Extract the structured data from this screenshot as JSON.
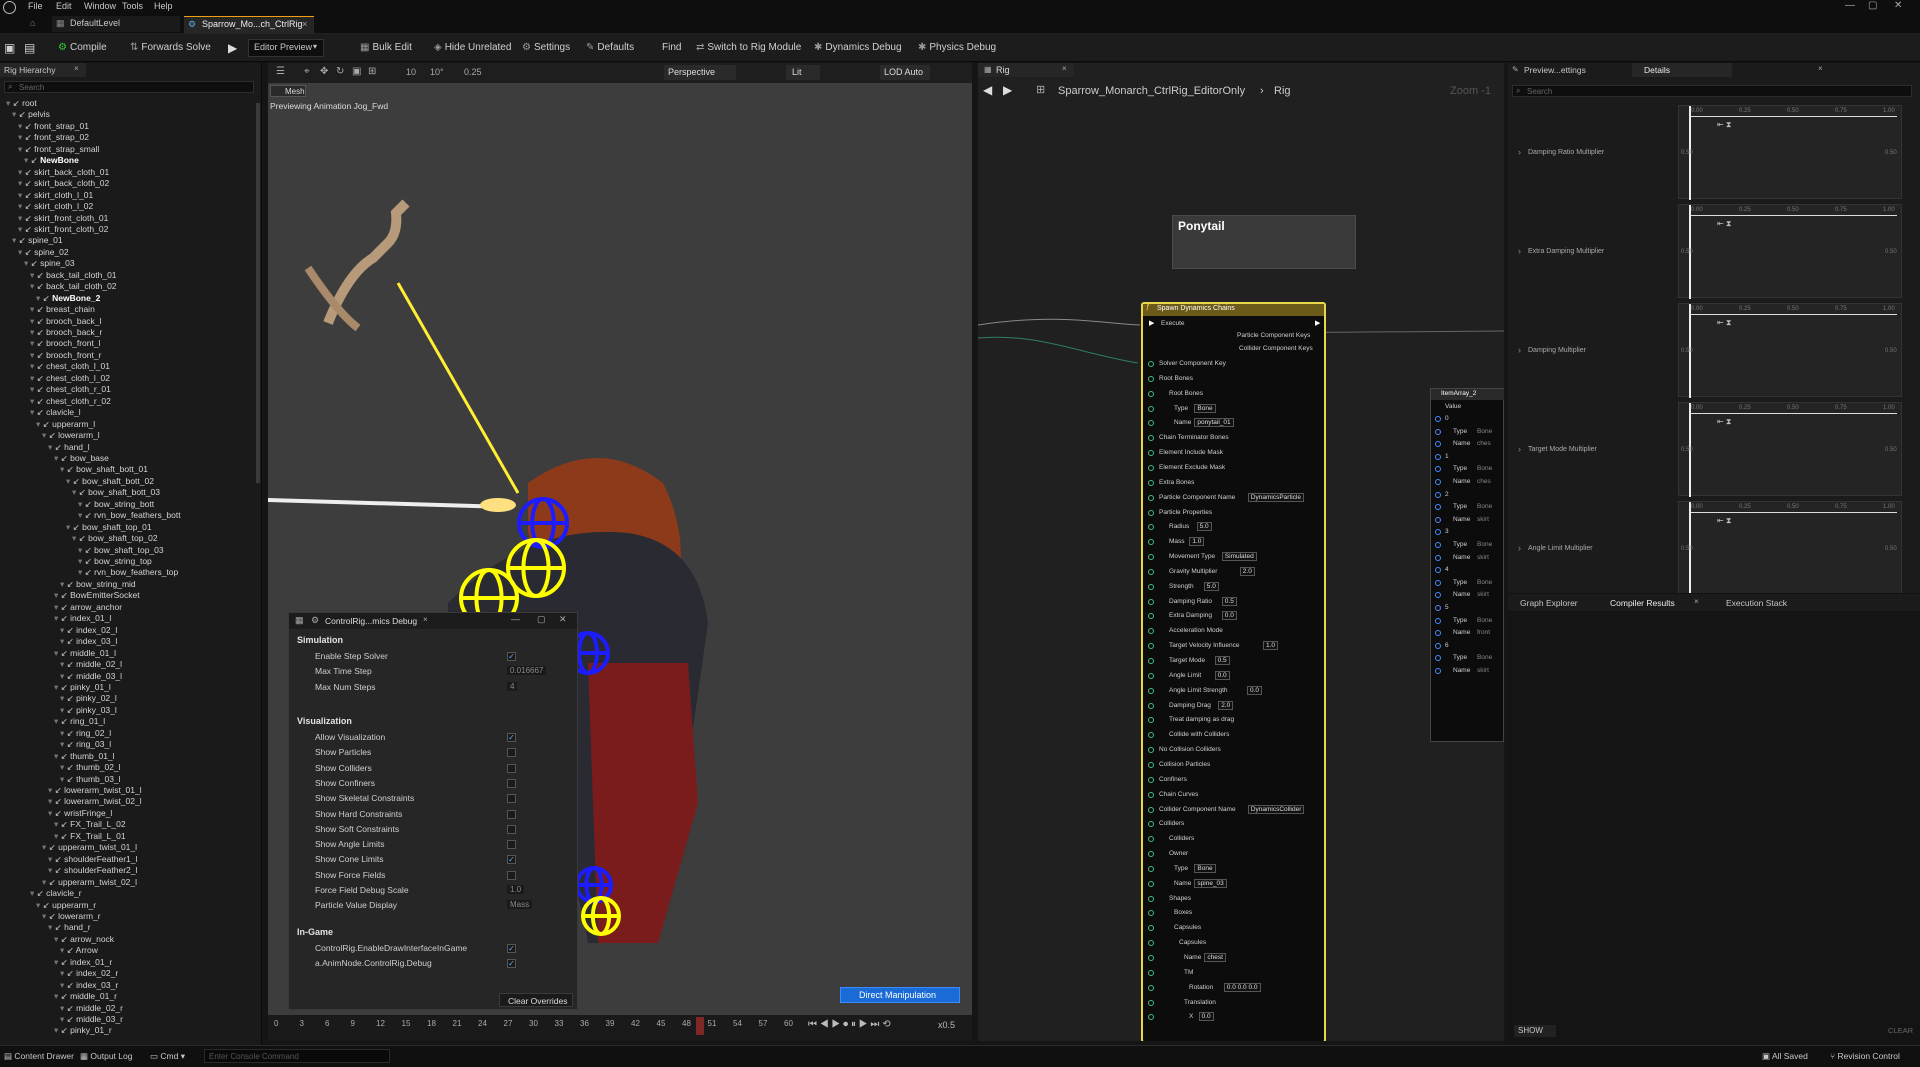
{
  "menu": {
    "items": [
      "File",
      "Edit",
      "Window",
      "Tools",
      "Help"
    ]
  },
  "tabs": [
    {
      "label": "DefaultLevel"
    },
    {
      "label": "Sparrow_Mo...ch_CtrlRig"
    }
  ],
  "toolbar": {
    "compile": "Compile",
    "forwards_solve": "Forwards Solve",
    "editor_preview": "Editor Preview",
    "bulk_edit": "Bulk Edit",
    "hide_unrelated": "Hide Unrelated",
    "settings": "Settings",
    "defaults": "Defaults",
    "find": "Find",
    "switch_rig": "Switch to Rig Module",
    "dynamics_debug": "Dynamics Debug",
    "physics_debug": "Physics Debug"
  },
  "hierarchy": {
    "title": "Rig Hierarchy",
    "search_placeholder": "Search",
    "items": [
      "root",
      "pelvis",
      "front_strap_01",
      "front_strap_02",
      "front_strap_small",
      "NewBone",
      "skirt_back_cloth_01",
      "skirt_back_cloth_02",
      "skirt_cloth_l_01",
      "skirt_cloth_l_02",
      "skirt_front_cloth_01",
      "skirt_front_cloth_02",
      "spine_01",
      "spine_02",
      "spine_03",
      "back_tail_cloth_01",
      "back_tail_cloth_02",
      "NewBone_2",
      "breast_chain",
      "brooch_back_l",
      "brooch_back_r",
      "brooch_front_l",
      "brooch_front_r",
      "chest_cloth_l_01",
      "chest_cloth_l_02",
      "chest_cloth_r_01",
      "chest_cloth_r_02",
      "clavicle_l",
      "upperarm_l",
      "lowerarm_l",
      "hand_l",
      "bow_base",
      "bow_shaft_bott_01",
      "bow_shaft_bott_02",
      "bow_shaft_bott_03",
      "bow_string_bott",
      "rvn_bow_feathers_bott",
      "bow_shaft_top_01",
      "bow_shaft_top_02",
      "bow_shaft_top_03",
      "bow_string_top",
      "rvn_bow_feathers_top",
      "bow_string_mid",
      "BowEmitterSocket",
      "arrow_anchor",
      "index_01_l",
      "index_02_l",
      "index_03_l",
      "middle_01_l",
      "middle_02_l",
      "middle_03_l",
      "pinky_01_l",
      "pinky_02_l",
      "pinky_03_l",
      "ring_01_l",
      "ring_02_l",
      "ring_03_l",
      "thumb_01_l",
      "thumb_02_l",
      "thumb_03_l",
      "lowerarm_twist_01_l",
      "lowerarm_twist_02_l",
      "wristFringe_l",
      "FX_Trail_L_02",
      "FX_Trail_L_01",
      "upperarm_twist_01_l",
      "shoulderFeather1_l",
      "shoulderFeather2_l",
      "upperarm_twist_02_l",
      "clavicle_r",
      "upperarm_r",
      "lowerarm_r",
      "hand_r",
      "arrow_nock",
      "Arrow",
      "index_01_r",
      "index_02_r",
      "index_03_r",
      "middle_01_r",
      "middle_02_r",
      "middle_03_r",
      "pinky_01_r"
    ]
  },
  "viewport": {
    "mesh_label": "Mesh",
    "preview_text": "Previewing Animation Jog_Fwd",
    "perspective": "Perspective",
    "lit": "Lit",
    "lod": "LOD Auto",
    "snap_val": "0.25",
    "snap_deg": "10°",
    "snap_grid": "10",
    "direct_manip": "Direct Manipulation",
    "timeline_ticks": [
      "0",
      "3",
      "6",
      "9",
      "12",
      "15",
      "18",
      "21",
      "24",
      "27",
      "30",
      "33",
      "36",
      "39",
      "42",
      "45",
      "48",
      "51",
      "54",
      "57",
      "60"
    ],
    "speed": "x0.5"
  },
  "debug_panel": {
    "title": "ControlRig...mics Debug",
    "sections": {
      "simulation": "Simulation",
      "visualization": "Visualization",
      "ingame": "In-Game"
    },
    "simulation": [
      {
        "label": "Enable Step Solver",
        "value": "✓"
      },
      {
        "label": "Max Time Step",
        "value": "0.016667"
      },
      {
        "label": "Max Num Steps",
        "value": "4"
      }
    ],
    "visualization": [
      {
        "label": "Allow Visualization",
        "value": "✓"
      },
      {
        "label": "Show Particles",
        "value": ""
      },
      {
        "label": "Show Colliders",
        "value": ""
      },
      {
        "label": "Show Confiners",
        "value": ""
      },
      {
        "label": "Show Skeletal Constraints",
        "value": ""
      },
      {
        "label": "Show Hard Constraints",
        "value": ""
      },
      {
        "label": "Show Soft Constraints",
        "value": ""
      },
      {
        "label": "Show Angle Limits",
        "value": ""
      },
      {
        "label": "Show Cone Limits",
        "value": "✓"
      },
      {
        "label": "Show Force Fields",
        "value": ""
      },
      {
        "label": "Force Field Debug Scale",
        "value": "1.0"
      },
      {
        "label": "Particle Value Display",
        "value": "Mass"
      }
    ],
    "ingame": [
      {
        "label": "ControlRig.EnableDrawInterfaceInGame",
        "value": "✓"
      },
      {
        "label": "a.AnimNode.ControlRig.Debug",
        "value": "✓"
      }
    ],
    "clear": "Clear Overrides"
  },
  "graph": {
    "tab": "Rig",
    "breadcrumb_asset": "Sparrow_Monarch_CtrlRig_EditorOnly",
    "breadcrumb_graph": "Rig",
    "zoom": "Zoom -1",
    "comment": "Ponytail",
    "node_title": "Spawn Dynamics Chains",
    "execute": "Execute",
    "particle_keys": "Particle Component Keys",
    "collider_keys": "Collider Component Keys",
    "node_rows": [
      {
        "label": "Solver Component Key",
        "value": ""
      },
      {
        "label": "Root Bones",
        "value": ""
      },
      {
        "label": "Root Bones",
        "value": ""
      },
      {
        "label": "Type",
        "value": "Bone"
      },
      {
        "label": "Name",
        "value": "ponytail_01"
      },
      {
        "label": "Chain Terminator Bones",
        "value": ""
      },
      {
        "label": "Element Include Mask",
        "value": ""
      },
      {
        "label": "Element Exclude Mask",
        "value": ""
      },
      {
        "label": "Extra Bones",
        "value": ""
      },
      {
        "label": "Particle Component Name",
        "value": "DynamicsParticle"
      },
      {
        "label": "Particle Properties",
        "value": ""
      },
      {
        "label": "Radius",
        "value": "5.0"
      },
      {
        "label": "Mass",
        "value": "1.0"
      },
      {
        "label": "Movement Type",
        "value": "Simulated"
      },
      {
        "label": "Gravity Multiplier",
        "value": "2.0"
      },
      {
        "label": "Strength",
        "value": "5.0"
      },
      {
        "label": "Damping Ratio",
        "value": "0.5"
      },
      {
        "label": "Extra Damping",
        "value": "0.0"
      },
      {
        "label": "Acceleration Mode",
        "value": ""
      },
      {
        "label": "Target Velocity Influence",
        "value": "1.0"
      },
      {
        "label": "Target Mode",
        "value": "0.5"
      },
      {
        "label": "Angle Limit",
        "value": "0.0"
      },
      {
        "label": "Angle Limit Strength",
        "value": "0.0"
      },
      {
        "label": "Damping Drag",
        "value": "2.0"
      },
      {
        "label": "Treat damping as drag",
        "value": ""
      },
      {
        "label": "Collide with Colliders",
        "value": ""
      },
      {
        "label": "No Collision Colliders",
        "value": ""
      },
      {
        "label": "Collision Particles",
        "value": ""
      },
      {
        "label": "Confiners",
        "value": ""
      },
      {
        "label": "Chain Curves",
        "value": ""
      },
      {
        "label": "Collider Component Name",
        "value": "DynamicsCollider"
      },
      {
        "label": "Colliders",
        "value": ""
      },
      {
        "label": "Colliders",
        "value": ""
      },
      {
        "label": "Owner",
        "value": ""
      },
      {
        "label": "Type",
        "value": "Bone"
      },
      {
        "label": "Name",
        "value": "spine_03"
      },
      {
        "label": "Shapes",
        "value": ""
      },
      {
        "label": "Boxes",
        "value": ""
      },
      {
        "label": "Capsules",
        "value": ""
      },
      {
        "label": "Capsules",
        "value": ""
      },
      {
        "label": "Name",
        "value": "chest"
      },
      {
        "label": "TM",
        "value": ""
      },
      {
        "label": "Rotation",
        "value": "0.0  0.0  0.0"
      },
      {
        "label": "Translation",
        "value": ""
      },
      {
        "label": "X",
        "value": "0.0"
      }
    ],
    "array_node": "ItemArray_2",
    "array_value": "Value",
    "array_rows": [
      {
        "label": "0",
        "value": ""
      },
      {
        "label": "Type",
        "value": "Bone"
      },
      {
        "label": "Name",
        "value": "ches"
      },
      {
        "label": "1",
        "value": ""
      },
      {
        "label": "Type",
        "value": "Bone"
      },
      {
        "label": "Name",
        "value": "ches"
      },
      {
        "label": "2",
        "value": ""
      },
      {
        "label": "Type",
        "value": "Bone"
      },
      {
        "label": "Name",
        "value": "skirt"
      },
      {
        "label": "3",
        "value": ""
      },
      {
        "label": "Type",
        "value": "Bone"
      },
      {
        "label": "Name",
        "value": "skirt"
      },
      {
        "label": "4",
        "value": ""
      },
      {
        "label": "Type",
        "value": "Bone"
      },
      {
        "label": "Name",
        "value": "skirt"
      },
      {
        "label": "5",
        "value": ""
      },
      {
        "label": "Type",
        "value": "Bone"
      },
      {
        "label": "Name",
        "value": "front"
      },
      {
        "label": "6",
        "value": ""
      },
      {
        "label": "Type",
        "value": "Bone"
      },
      {
        "label": "Name",
        "value": "skirt"
      }
    ]
  },
  "details": {
    "tab_preview": "Preview...ettings",
    "tab_details": "Details",
    "search_placeholder": "Search",
    "curves": [
      {
        "label": "Damping Ratio Multiplier"
      },
      {
        "label": "Extra Damping Multiplier"
      },
      {
        "label": "Damping Multiplier"
      },
      {
        "label": "Target Mode Multiplier"
      },
      {
        "label": "Angle Limit Multiplier"
      }
    ],
    "curve_ticks": [
      "0.00",
      "0.25",
      "0.50",
      "0.75",
      "1.00"
    ],
    "curve_y": "0.50",
    "bottom_tabs": [
      "Graph Explorer",
      "Compiler Results",
      "Execution Stack"
    ],
    "show": "SHOW",
    "clear": "CLEAR"
  },
  "status": {
    "content_drawer": "Content Drawer",
    "output_log": "Output Log",
    "cmd": "Cmd",
    "console_placeholder": "Enter Console Command",
    "saved": "All Saved",
    "revision": "Revision Control"
  },
  "colors": {
    "accent": "#1a6bd6",
    "node_border": "#e8d74a",
    "control_yellow": "#ffff00",
    "control_blue": "#1c1cff"
  }
}
